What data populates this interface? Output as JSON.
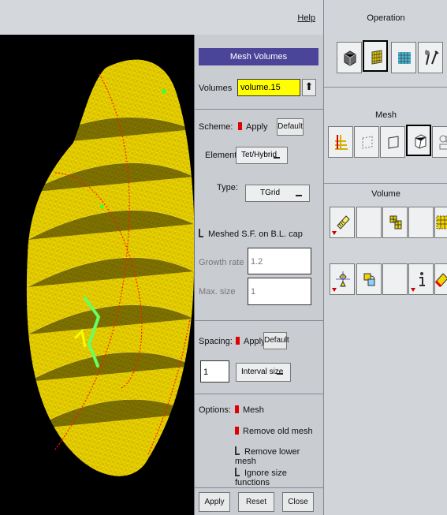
{
  "header": {
    "help": "Help"
  },
  "viewport": {
    "name": "mesh-preview"
  },
  "panel": {
    "title": "Mesh Volumes",
    "volumes_label": "Volumes",
    "volume_value": "volume.15",
    "scheme_label": "Scheme:",
    "scheme_apply": "Apply",
    "scheme_default": "Default",
    "elements_label": "Elements:",
    "elements_value": "Tet/Hybrid",
    "type_label": "Type:",
    "type_value": "TGrid",
    "meshed_sf": "Meshed S.F. on B.L. cap",
    "growth_rate_label": "Growth rate",
    "growth_rate_value": "1.2",
    "max_size_label": "Max. size",
    "max_size_value": "1",
    "spacing_label": "Spacing:",
    "spacing_apply": "Apply",
    "spacing_default": "Default",
    "spacing_value": "1",
    "interval_size": "Interval size",
    "options_label": "Options:",
    "option_mesh": "Mesh",
    "option_remove_old": "Remove old mesh",
    "option_remove_lower": "Remove lower mesh",
    "option_ignore_size": "Ignore size functions",
    "apply": "Apply",
    "reset": "Reset",
    "close": "Close"
  },
  "toolbar": {
    "operation": "Operation",
    "mesh": "Mesh",
    "volume": "Volume",
    "icons": {
      "operation": [
        "geometry-cube-icon",
        "mesh-icon",
        "grid-icon",
        "tools-icon"
      ],
      "mesh": [
        "boundary-layer-icon",
        "edge-mesh-icon",
        "face-mesh-icon",
        "volume-mesh-icon",
        "group-mesh-icon"
      ],
      "volume": [
        "create-volume-icon",
        "blank-icon",
        "split-volume-icon",
        "blank-icon",
        "dotted-volume-icon",
        "move-volume-icon",
        "link-volume-icon",
        "blank-icon",
        "info-icon",
        "erase-icon"
      ]
    }
  },
  "colors": {
    "panel": "#c9ccd1",
    "title": "#4a4599",
    "mesh": "#e8d100",
    "red": "#e00000"
  }
}
